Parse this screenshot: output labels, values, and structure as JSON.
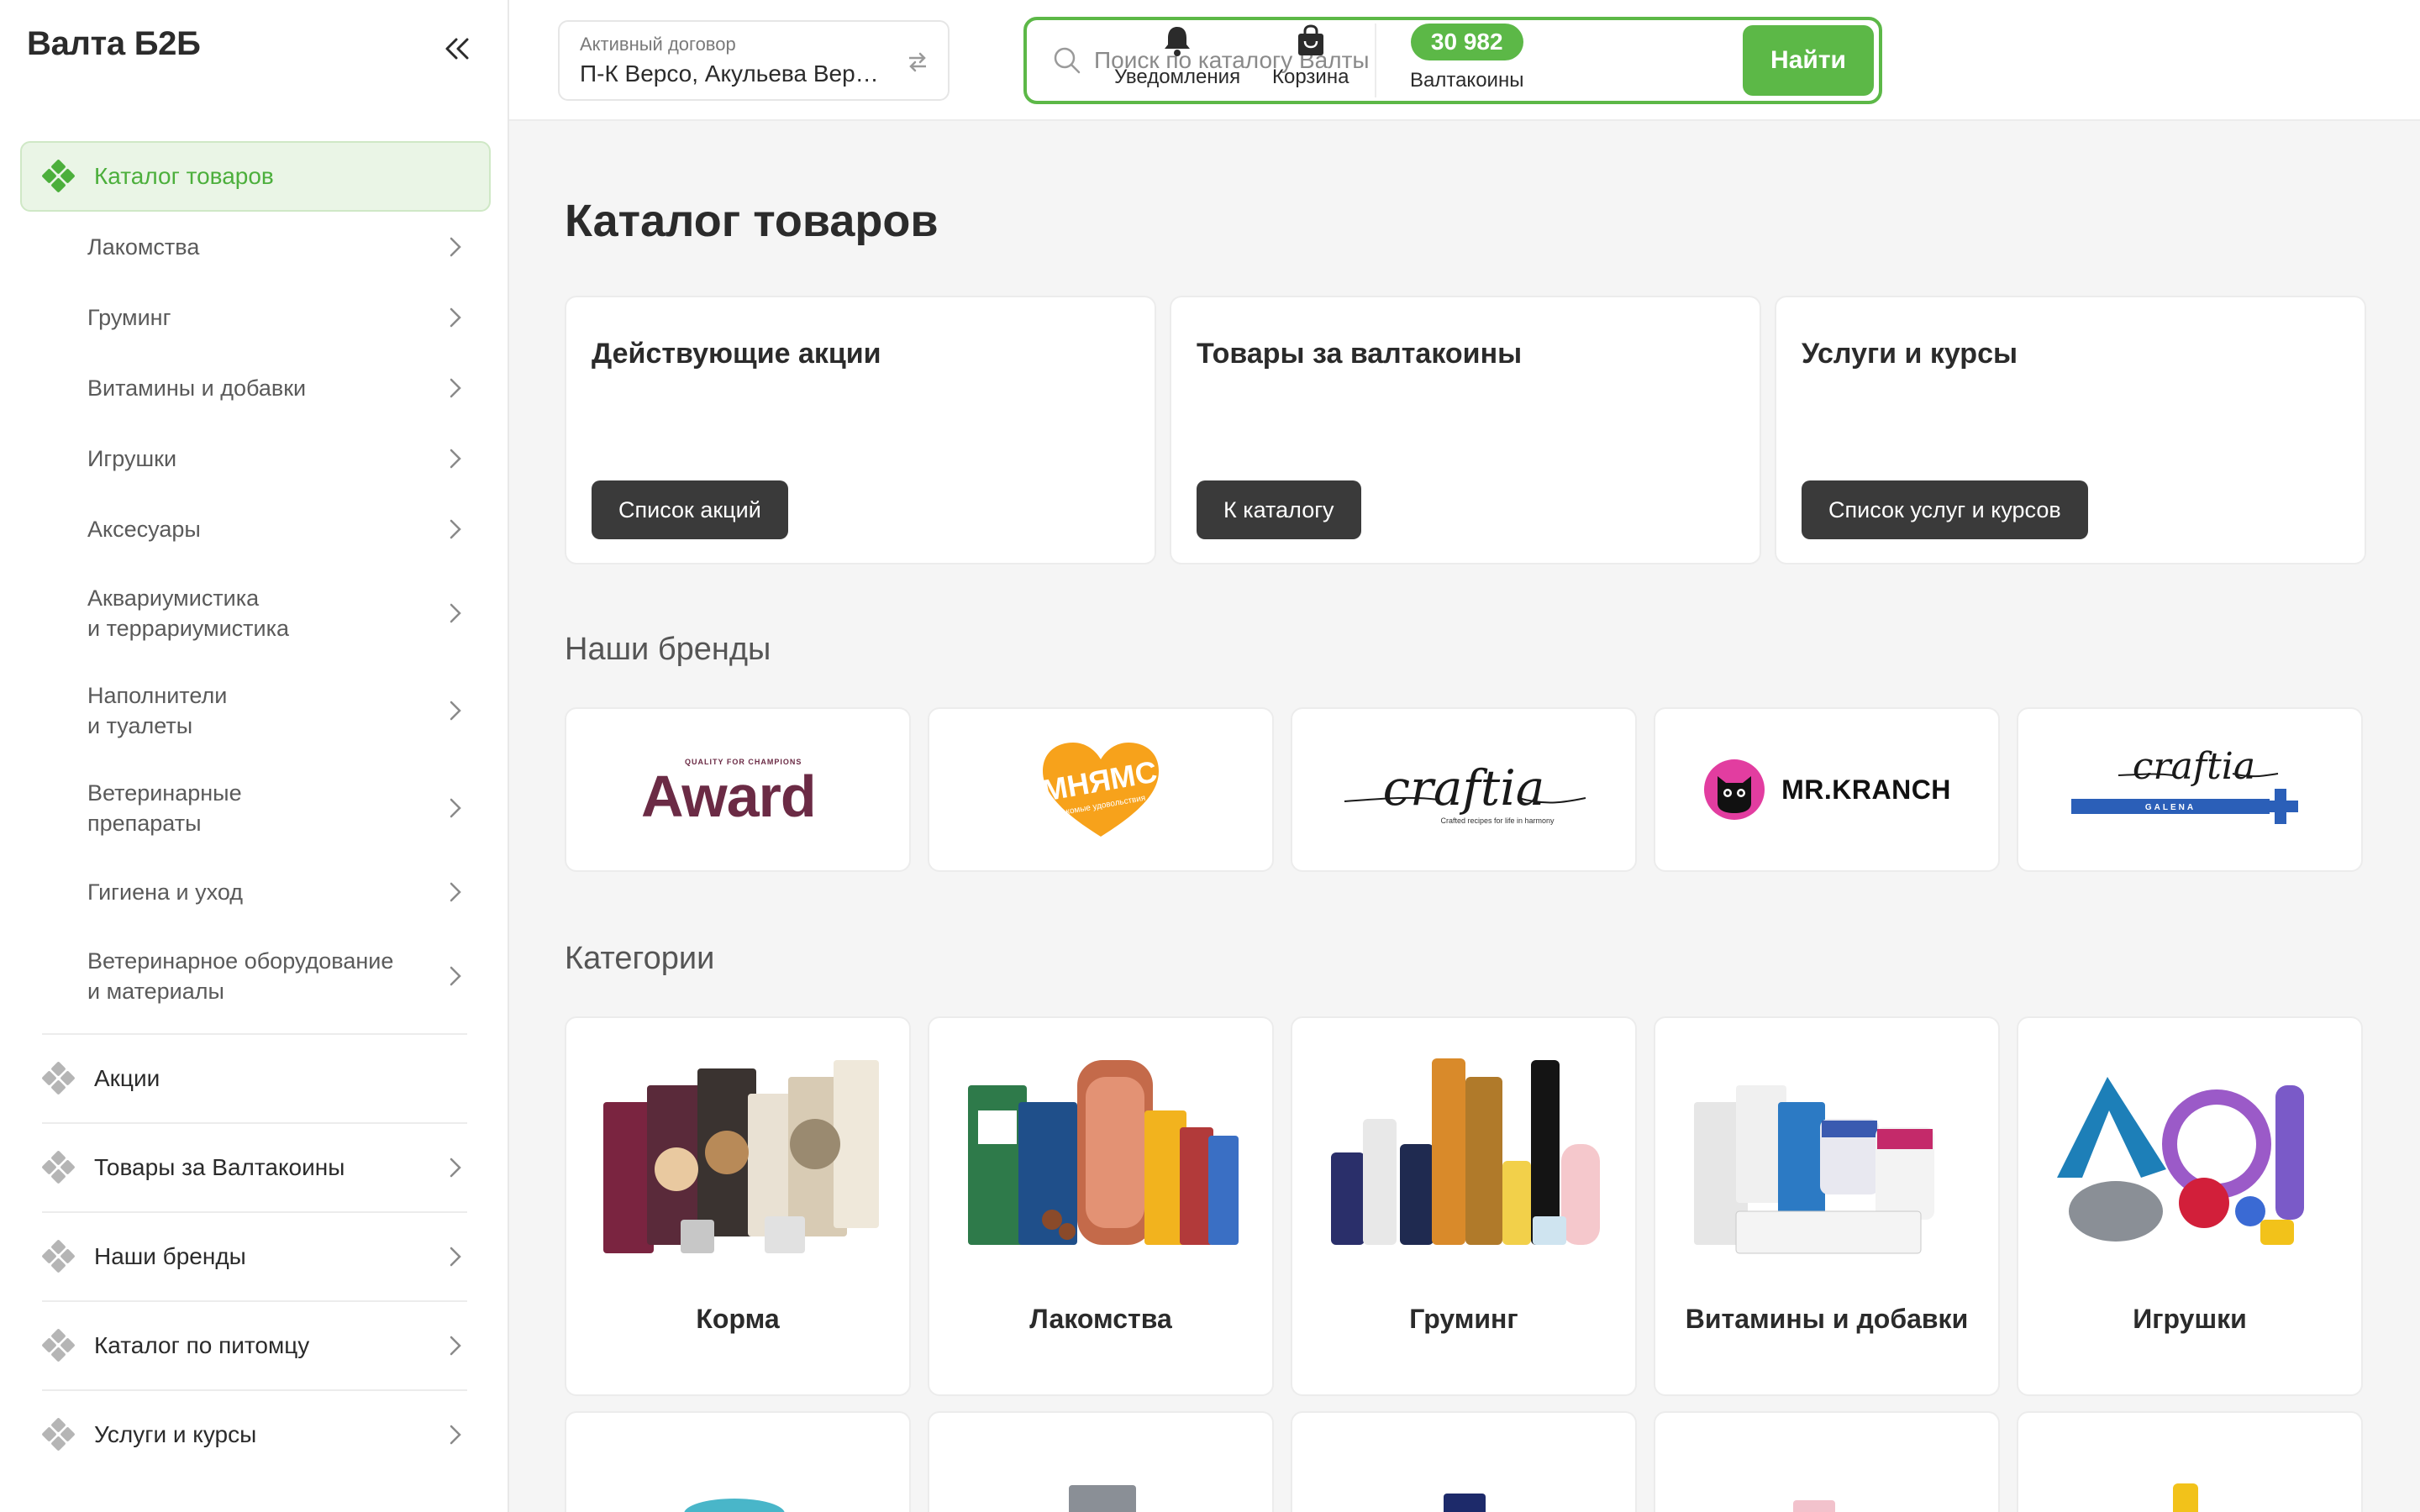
{
  "app": {
    "title": "Валта Б2Б"
  },
  "sidebar": {
    "active": {
      "label": "Каталог товаров"
    },
    "sub_items": [
      {
        "label": "Лакомства"
      },
      {
        "label": "Груминг"
      },
      {
        "label": "Витамины и добавки"
      },
      {
        "label": "Игрушки"
      },
      {
        "label": "Аксесуары"
      },
      {
        "label": "Аквариумистика\nи террариумистика"
      },
      {
        "label": "Наполнители\nи туалеты"
      },
      {
        "label": "Ветеринарные\nпрепараты"
      },
      {
        "label": "Гигиена и уход"
      },
      {
        "label": "Ветеринарное оборудование\nи материалы"
      }
    ],
    "main_items": [
      {
        "label": "Акции"
      },
      {
        "label": "Товары за Валтакоины"
      },
      {
        "label": "Наши бренды"
      },
      {
        "label": "Каталог по питомцу"
      },
      {
        "label": "Услуги и курсы"
      }
    ]
  },
  "header": {
    "contract": {
      "caption": "Активный договор",
      "value": "П-К Версо, Акульева Вероника"
    },
    "search": {
      "placeholder": "Поиск по каталогу Валты",
      "button": "Найти"
    },
    "notifications": {
      "label": "Уведомления"
    },
    "cart": {
      "label": "Корзина"
    },
    "coins": {
      "value": "30 982",
      "label": "Валтакоины"
    }
  },
  "main": {
    "title": "Каталог товаров",
    "promos": [
      {
        "title": "Действующие акции",
        "button": "Список акций"
      },
      {
        "title": "Товары за валтакоины",
        "button": "К каталогу"
      },
      {
        "title": "Услуги и курсы",
        "button": "Список услуг и курсов"
      }
    ],
    "brands_title": "Наши бренды",
    "brands": [
      {
        "name": "Award",
        "tagline": "QUALITY FOR CHAMPIONS"
      },
      {
        "name": "МНЯМС",
        "tagline": "лакомые удовольствия"
      },
      {
        "name": "craftia",
        "tagline": "Crafted recipes for life in harmony"
      },
      {
        "name": "MR.KRANCH"
      },
      {
        "name": "craftia",
        "tagline": "GALENA"
      }
    ],
    "categories_title": "Категории",
    "categories": [
      {
        "label": "Корма"
      },
      {
        "label": "Лакомства"
      },
      {
        "label": "Груминг"
      },
      {
        "label": "Витамины и добавки"
      },
      {
        "label": "Игрушки"
      }
    ]
  },
  "colors": {
    "accent": "#5cb847",
    "dark_button": "#3a3a3a",
    "award": "#6b2b45",
    "mnyams": "#f7a21b",
    "galena_blue": "#2b5fb8"
  }
}
